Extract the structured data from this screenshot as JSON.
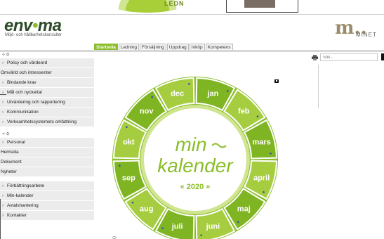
{
  "background": {
    "partial_text": "LEDN"
  },
  "header": {
    "logo": {
      "part1": "env",
      "dot": "•",
      "part2": "ma"
    },
    "tagline": "Miljö- och hållbarhetskonsulter",
    "brand_right": {
      "letter": "m..",
      "sub": "MINET"
    }
  },
  "topnav": {
    "tabs": [
      {
        "label": "Startsida",
        "active": true
      },
      {
        "label": "Ledning",
        "active": false
      },
      {
        "label": "Försäljning",
        "active": false
      },
      {
        "label": "Uppdrag",
        "active": false
      },
      {
        "label": "Inköp",
        "active": false
      },
      {
        "label": "Kompetens",
        "active": false
      }
    ]
  },
  "sidebar": {
    "group1_head": "⟡ ⚙",
    "group1": [
      {
        "label": "Policy och värdeord",
        "chevron": true
      },
      {
        "label": "Omvärld och intressenter",
        "chevron": false
      },
      {
        "label": "Bindande krav",
        "chevron": true
      },
      {
        "label": "Mål och nyckeltal",
        "chevron": true
      },
      {
        "label": "Utvärdering och rapportering",
        "chevron": true
      },
      {
        "label": "Kommunikation",
        "chevron": true
      },
      {
        "label": "Verksamhetssystemets omfattning",
        "chevron": true
      }
    ],
    "group2_head": "⟡ ⚙",
    "group2": [
      {
        "label": "Personal",
        "chevron": true
      },
      {
        "label": "Hemsida",
        "chevron": false
      },
      {
        "label": "Dokument",
        "chevron": false
      },
      {
        "label": "Nyheter",
        "chevron": false
      }
    ],
    "group3": [
      {
        "label": "Förbättringsarbete",
        "chevron": true
      },
      {
        "label": "Min-kalender",
        "chevron": true
      },
      {
        "label": "Avtalshantering",
        "chevron": true
      },
      {
        "label": "Kontakter",
        "chevron": true
      }
    ],
    "chevron_glyph": "›"
  },
  "toolbar": {
    "search_placeholder": "Sök..."
  },
  "calendar": {
    "title_line1": "min",
    "title_line2": "kalender",
    "year": "« 2020 »",
    "months": [
      "jan",
      "feb",
      "mars",
      "april",
      "maj",
      "juni",
      "juli",
      "aug",
      "sep",
      "okt",
      "nov",
      "dec"
    ],
    "colors": {
      "outer": "#8bbe2a",
      "dark": "#7fb422",
      "light": "#a6cd3f",
      "ring": "#cfe58f",
      "title": "#8bbe2a",
      "dot": "#3c4fa5"
    }
  }
}
